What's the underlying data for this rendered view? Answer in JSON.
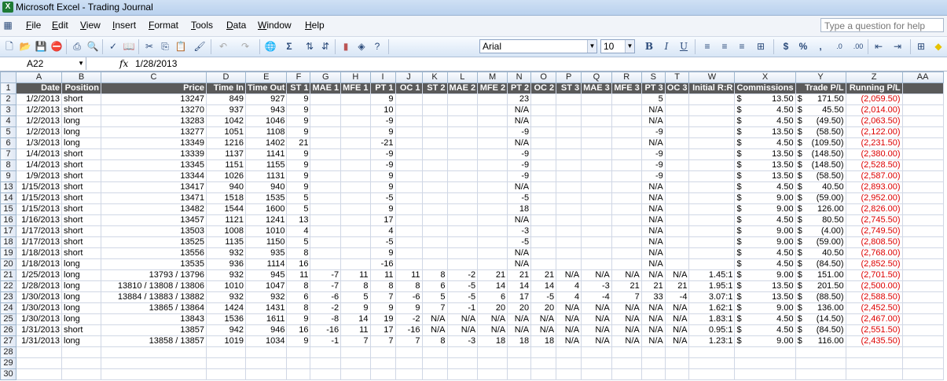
{
  "window": {
    "title": "Microsoft Excel - Trading Journal"
  },
  "menu": {
    "items": [
      "File",
      "Edit",
      "View",
      "Insert",
      "Format",
      "Tools",
      "Data",
      "Window",
      "Help"
    ],
    "help_placeholder": "Type a question for help"
  },
  "toolbar": {
    "font": "Arial",
    "size": "10"
  },
  "formula_bar": {
    "cell_ref": "A22",
    "fx": "fx",
    "content": "1/28/2013"
  },
  "columns": [
    "A",
    "B",
    "C",
    "D",
    "E",
    "F",
    "G",
    "H",
    "I",
    "J",
    "K",
    "L",
    "M",
    "N",
    "O",
    "P",
    "Q",
    "R",
    "S",
    "T",
    "W",
    "X",
    "Y",
    "Z",
    "AA"
  ],
  "headers": [
    "Date",
    "Position",
    "Price",
    "Time In",
    "Time Out",
    "ST 1",
    "MAE 1",
    "MFE 1",
    "PT 1",
    "OC 1",
    "ST 2",
    "MAE 2",
    "MFE 2",
    "PT 2",
    "OC 2",
    "ST 3",
    "MAE 3",
    "MFE 3",
    "PT 3",
    "OC 3",
    "Initial R:R",
    "Commissions",
    "Trade P/L",
    "Running P/L",
    ""
  ],
  "rows": [
    {
      "n": "2",
      "c": [
        "1/2/2013",
        "short",
        "13247",
        "849",
        "927",
        "9",
        "",
        "",
        "9",
        "",
        "",
        "",
        "",
        "23",
        "",
        "",
        "",
        "",
        "5",
        "",
        "",
        "$|13.50",
        "$|171.50",
        "(2,059.50)",
        ""
      ]
    },
    {
      "n": "3",
      "c": [
        "1/2/2013",
        "short",
        "13270",
        "937",
        "943",
        "9",
        "",
        "",
        "10",
        "",
        "",
        "",
        "",
        "N/A",
        "",
        "",
        "",
        "",
        "N/A",
        "",
        "",
        "$|4.50",
        "$|45.50",
        "(2,014.00)",
        ""
      ]
    },
    {
      "n": "4",
      "c": [
        "1/2/2013",
        "long",
        "13283",
        "1042",
        "1046",
        "9",
        "",
        "",
        "-9",
        "",
        "",
        "",
        "",
        "N/A",
        "",
        "",
        "",
        "",
        "N/A",
        "",
        "",
        "$|4.50",
        "$|(49.50)",
        "(2,063.50)",
        ""
      ]
    },
    {
      "n": "5",
      "c": [
        "1/2/2013",
        "long",
        "13277",
        "1051",
        "1108",
        "9",
        "",
        "",
        "9",
        "",
        "",
        "",
        "",
        "-9",
        "",
        "",
        "",
        "",
        "-9",
        "",
        "",
        "$|13.50",
        "$|(58.50)",
        "(2,122.00)",
        ""
      ]
    },
    {
      "n": "6",
      "c": [
        "1/3/2013",
        "long",
        "13349",
        "1216",
        "1402",
        "21",
        "",
        "",
        "-21",
        "",
        "",
        "",
        "",
        "N/A",
        "",
        "",
        "",
        "",
        "N/A",
        "",
        "",
        "$|4.50",
        "$|(109.50)",
        "(2,231.50)",
        ""
      ]
    },
    {
      "n": "7",
      "c": [
        "1/4/2013",
        "short",
        "13339",
        "1137",
        "1141",
        "9",
        "",
        "",
        "-9",
        "",
        "",
        "",
        "",
        "-9",
        "",
        "",
        "",
        "",
        "-9",
        "",
        "",
        "$|13.50",
        "$|(148.50)",
        "(2,380.00)",
        ""
      ]
    },
    {
      "n": "8",
      "c": [
        "1/4/2013",
        "short",
        "13345",
        "1151",
        "1155",
        "9",
        "",
        "",
        "-9",
        "",
        "",
        "",
        "",
        "-9",
        "",
        "",
        "",
        "",
        "-9",
        "",
        "",
        "$|13.50",
        "$|(148.50)",
        "(2,528.50)",
        ""
      ]
    },
    {
      "n": "9",
      "c": [
        "1/9/2013",
        "short",
        "13344",
        "1026",
        "1131",
        "9",
        "",
        "",
        "9",
        "",
        "",
        "",
        "",
        "-9",
        "",
        "",
        "",
        "",
        "-9",
        "",
        "",
        "$|13.50",
        "$|(58.50)",
        "(2,587.00)",
        ""
      ]
    },
    {
      "n": "13",
      "c": [
        "1/15/2013",
        "short",
        "13417",
        "940",
        "940",
        "9",
        "",
        "",
        "9",
        "",
        "",
        "",
        "",
        "N/A",
        "",
        "",
        "",
        "",
        "N/A",
        "",
        "",
        "$|4.50",
        "$|40.50",
        "(2,893.00)",
        ""
      ]
    },
    {
      "n": "14",
      "c": [
        "1/15/2013",
        "short",
        "13471",
        "1518",
        "1535",
        "5",
        "",
        "",
        "-5",
        "",
        "",
        "",
        "",
        "-5",
        "",
        "",
        "",
        "",
        "N/A",
        "",
        "",
        "$|9.00",
        "$|(59.00)",
        "(2,952.00)",
        ""
      ]
    },
    {
      "n": "15",
      "c": [
        "1/15/2013",
        "short",
        "13482",
        "1544",
        "1600",
        "5",
        "",
        "",
        "9",
        "",
        "",
        "",
        "",
        "18",
        "",
        "",
        "",
        "",
        "N/A",
        "",
        "",
        "$|9.00",
        "$|126.00",
        "(2,826.00)",
        ""
      ]
    },
    {
      "n": "16",
      "c": [
        "1/16/2013",
        "short",
        "13457",
        "1121",
        "1241",
        "13",
        "",
        "",
        "17",
        "",
        "",
        "",
        "",
        "N/A",
        "",
        "",
        "",
        "",
        "N/A",
        "",
        "",
        "$|4.50",
        "$|80.50",
        "(2,745.50)",
        ""
      ]
    },
    {
      "n": "17",
      "c": [
        "1/17/2013",
        "short",
        "13503",
        "1008",
        "1010",
        "4",
        "",
        "",
        "4",
        "",
        "",
        "",
        "",
        "-3",
        "",
        "",
        "",
        "",
        "N/A",
        "",
        "",
        "$|9.00",
        "$|(4.00)",
        "(2,749.50)",
        ""
      ]
    },
    {
      "n": "18",
      "c": [
        "1/17/2013",
        "short",
        "13525",
        "1135",
        "1150",
        "5",
        "",
        "",
        "-5",
        "",
        "",
        "",
        "",
        "-5",
        "",
        "",
        "",
        "",
        "N/A",
        "",
        "",
        "$|9.00",
        "$|(59.00)",
        "(2,808.50)",
        ""
      ]
    },
    {
      "n": "19",
      "c": [
        "1/18/2013",
        "short",
        "13556",
        "932",
        "935",
        "8",
        "",
        "",
        "9",
        "",
        "",
        "",
        "",
        "N/A",
        "",
        "",
        "",
        "",
        "N/A",
        "",
        "",
        "$|4.50",
        "$|40.50",
        "(2,768.00)",
        ""
      ]
    },
    {
      "n": "20",
      "c": [
        "1/18/2013",
        "long",
        "13535",
        "936",
        "1114",
        "16",
        "",
        "",
        "-16",
        "",
        "",
        "",
        "",
        "N/A",
        "",
        "",
        "",
        "",
        "N/A",
        "",
        "",
        "$|4.50",
        "$|(84.50)",
        "(2,852.50)",
        ""
      ]
    },
    {
      "n": "21",
      "c": [
        "1/25/2013",
        "long",
        "13793 / 13796",
        "932",
        "945",
        "11",
        "-7",
        "11",
        "11",
        "11",
        "8",
        "-2",
        "21",
        "21",
        "21",
        "N/A",
        "N/A",
        "N/A",
        "N/A",
        "N/A",
        "1.45:1",
        "$|9.00",
        "$|151.00",
        "(2,701.50)",
        ""
      ]
    },
    {
      "n": "22",
      "c": [
        "1/28/2013",
        "long",
        "13810 / 13808 / 13806",
        "1010",
        "1047",
        "8",
        "-7",
        "8",
        "8",
        "8",
        "6",
        "-5",
        "14",
        "14",
        "14",
        "4",
        "-3",
        "21",
        "21",
        "21",
        "1.95:1",
        "$|13.50",
        "$|201.50",
        "(2,500.00)",
        ""
      ]
    },
    {
      "n": "23",
      "c": [
        "1/30/2013",
        "long",
        "13884 / 13883 / 13882",
        "932",
        "932",
        "6",
        "-6",
        "5",
        "7",
        "-6",
        "5",
        "-5",
        "6",
        "17",
        "-5",
        "4",
        "-4",
        "7",
        "33",
        "-4",
        "3.07:1",
        "$|13.50",
        "$|(88.50)",
        "(2,588.50)",
        ""
      ]
    },
    {
      "n": "24",
      "c": [
        "1/30/2013",
        "long",
        "13865 / 13864",
        "1424",
        "1431",
        "8",
        "-2",
        "9",
        "9",
        "9",
        "7",
        "-1",
        "20",
        "20",
        "20",
        "N/A",
        "N/A",
        "N/A",
        "N/A",
        "N/A",
        "1.62:1",
        "$|9.00",
        "$|136.00",
        "(2,452.50)",
        ""
      ]
    },
    {
      "n": "25",
      "c": [
        "1/30/2013",
        "long",
        "13843",
        "1536",
        "1611",
        "9",
        "-8",
        "14",
        "19",
        "-2",
        "N/A",
        "N/A",
        "N/A",
        "N/A",
        "N/A",
        "N/A",
        "N/A",
        "N/A",
        "N/A",
        "N/A",
        "1.83:1",
        "$|4.50",
        "$|(14.50)",
        "(2,467.00)",
        ""
      ]
    },
    {
      "n": "26",
      "c": [
        "1/31/2013",
        "short",
        "13857",
        "942",
        "946",
        "16",
        "-16",
        "11",
        "17",
        "-16",
        "N/A",
        "N/A",
        "N/A",
        "N/A",
        "N/A",
        "N/A",
        "N/A",
        "N/A",
        "N/A",
        "N/A",
        "0.95:1",
        "$|4.50",
        "$|(84.50)",
        "(2,551.50)",
        ""
      ]
    },
    {
      "n": "27",
      "c": [
        "1/31/2013",
        "long",
        "13858 / 13857",
        "1019",
        "1034",
        "9",
        "-1",
        "7",
        "7",
        "7",
        "8",
        "-3",
        "18",
        "18",
        "18",
        "N/A",
        "N/A",
        "N/A",
        "N/A",
        "N/A",
        "1.23:1",
        "$|9.00",
        "$|116.00",
        "(2,435.50)",
        ""
      ]
    },
    {
      "n": "28",
      "c": [
        "",
        "",
        "",
        "",
        "",
        "",
        "",
        "",
        "",
        "",
        "",
        "",
        "",
        "",
        "",
        "",
        "",
        "",
        "",
        "",
        "",
        "",
        "",
        "",
        ""
      ]
    },
    {
      "n": "29",
      "c": [
        "",
        "",
        "",
        "",
        "",
        "",
        "",
        "",
        "",
        "",
        "",
        "",
        "",
        "",
        "",
        "",
        "",
        "",
        "",
        "",
        "",
        "",
        "",
        "",
        ""
      ]
    },
    {
      "n": "30",
      "c": [
        "",
        "",
        "",
        "",
        "",
        "",
        "",
        "",
        "",
        "",
        "",
        "",
        "",
        "",
        "",
        "",
        "",
        "",
        "",
        "",
        "",
        "",
        "",
        "",
        ""
      ]
    }
  ]
}
